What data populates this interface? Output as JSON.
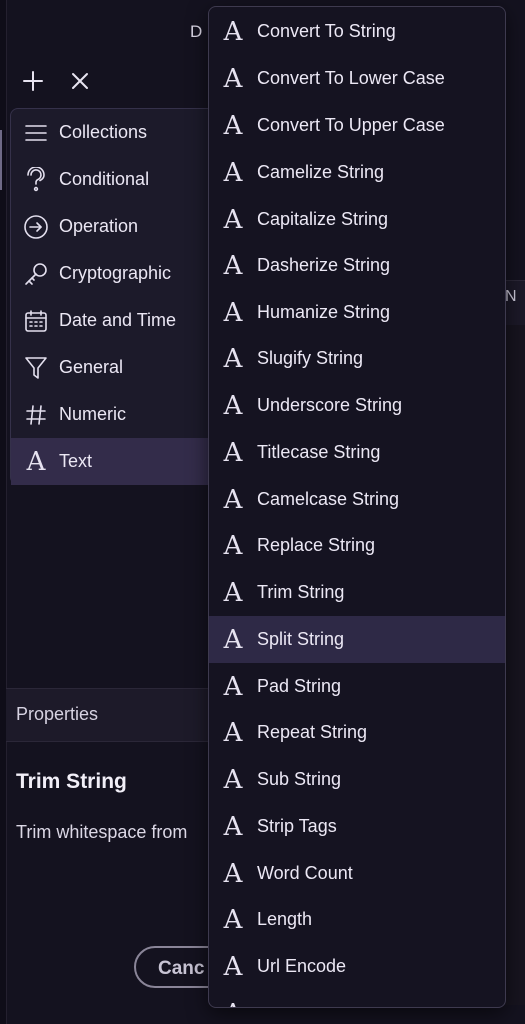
{
  "dialog": {
    "title_fragment": "D"
  },
  "toolbar": {
    "add_icon": "plus-icon",
    "close_icon": "close-icon"
  },
  "categories": [
    {
      "label": "Collections",
      "icon": "list-icon"
    },
    {
      "label": "Conditional",
      "icon": "question-icon"
    },
    {
      "label": "Operation",
      "icon": "arrow-circle-icon"
    },
    {
      "label": "Cryptographic",
      "icon": "key-icon"
    },
    {
      "label": "Date and Time",
      "icon": "calendar-icon"
    },
    {
      "label": "General",
      "icon": "filter-icon"
    },
    {
      "label": "Numeric",
      "icon": "hash-icon"
    },
    {
      "label": "Text",
      "icon": "text-a-icon",
      "active": true
    }
  ],
  "properties": {
    "header": "Properties",
    "title": "Trim String",
    "description": "Trim whitespace from"
  },
  "footer": {
    "cancel_label": "Canc"
  },
  "right_header_fragment": "N",
  "text_functions": [
    "Convert To String",
    "Convert To Lower Case",
    "Convert To Upper Case",
    "Camelize String",
    "Capitalize String",
    "Dasherize String",
    "Humanize String",
    "Slugify String",
    "Underscore String",
    "Titlecase String",
    "Camelcase String",
    "Replace String",
    "Trim String",
    "Split String",
    "Pad String",
    "Repeat String",
    "Sub String",
    "Strip Tags",
    "Word Count",
    "Length",
    "Url Encode"
  ],
  "highlighted_function": "Split String",
  "glyph": "A"
}
